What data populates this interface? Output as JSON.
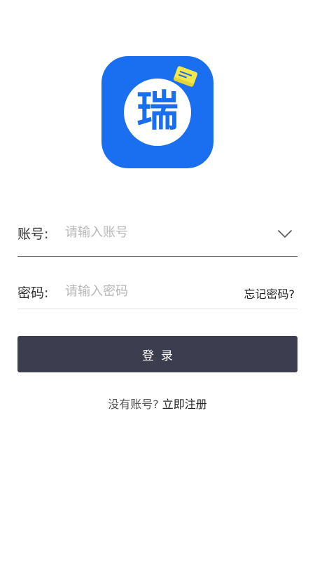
{
  "logo": {
    "character": "瑞",
    "background_color": "#1a6ff0",
    "card_color": "#f2e84a",
    "icon": "app-logo"
  },
  "account": {
    "label": "账号:",
    "placeholder": "请输入账号",
    "value": "",
    "dropdown_icon": "chevron-down-icon"
  },
  "password": {
    "label": "密码:",
    "placeholder": "请输入密码",
    "value": "",
    "forgot_label": "忘记密码?"
  },
  "login": {
    "button_label": "登录",
    "button_color": "#3c3d4f"
  },
  "register": {
    "prompt": "没有账号?",
    "link_label": "立即注册"
  }
}
